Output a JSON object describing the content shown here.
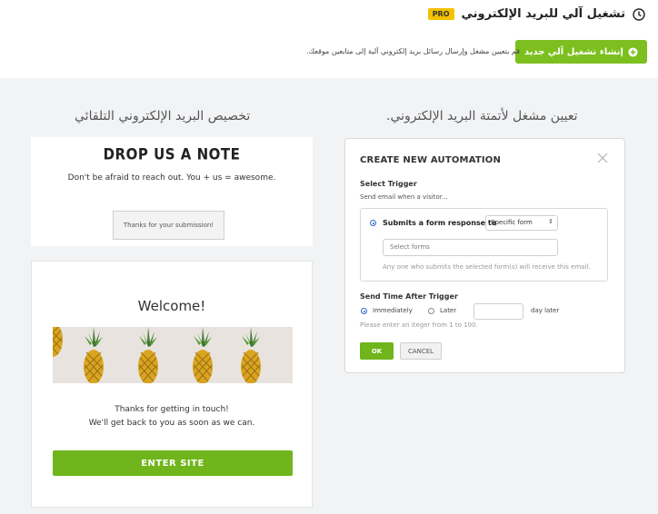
{
  "header": {
    "title": "تشغيل آلي للبريد الإلكتروني",
    "pro_badge": "PRO",
    "create_button": "إنشاء تشغيل آلي جديد",
    "description": "قم بتعيين مشغل وإرسال رسائل بريد إلكتروني آلية إلى متابعين موقعك."
  },
  "columns": {
    "left_heading": "تخصيص البريد الإلكتروني التلقائي",
    "right_heading": "تعيين مشغل لأتمتة البريد الإلكتروني."
  },
  "note_card": {
    "title": "DROP US A NOTE",
    "subtitle": "Don't be afraid to reach out. You + us = awesome.",
    "submitted": "Thanks for your submission!"
  },
  "welcome_card": {
    "title": "Welcome!",
    "line1": "Thanks for getting in touch!",
    "line2": "We'll get back to you as soon as we can.",
    "button": "ENTER SITE"
  },
  "automation": {
    "title": "CREATE NEW AUTOMATION",
    "select_trigger": "Select Trigger",
    "send_when": "Send email when a visitor...",
    "option_submit": "Submits a form response to",
    "select_value": "Specific form",
    "forms_placeholder": "Select forms",
    "forms_hint": "Any one who submits the selected form(s) will receive this email.",
    "send_time": "Send Time After Trigger",
    "immediately": "Immediately",
    "later": "Later",
    "day_later": "day later",
    "hint": "Please enter an itеger  from 1 to 100.",
    "ok": "OK",
    "cancel": "CANCEL"
  },
  "colors": {
    "accent_green": "#7cbf1e",
    "pro_yellow": "#f2c200",
    "radio_blue": "#2a6acb"
  }
}
